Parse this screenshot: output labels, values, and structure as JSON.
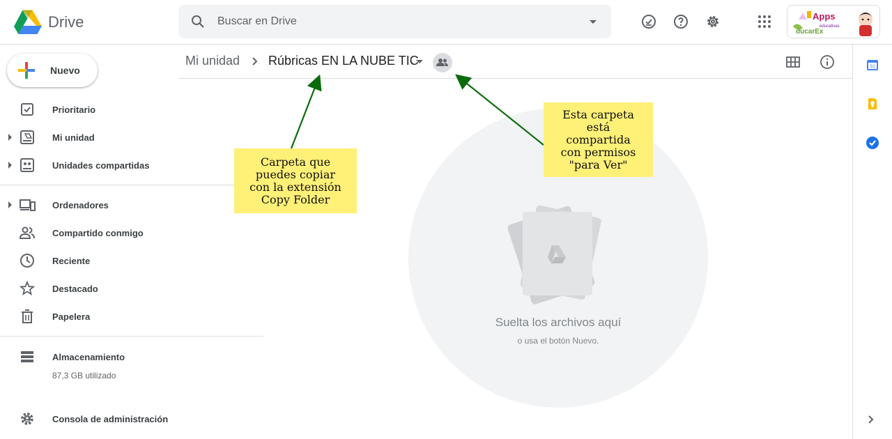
{
  "app": {
    "name": "Drive"
  },
  "search": {
    "placeholder": "Buscar en Drive"
  },
  "header_icons": [
    "offline-ready-icon",
    "help-icon",
    "settings-icon",
    "apps-grid-icon"
  ],
  "account": {
    "logo_text_top": "Apps",
    "logo_text_sub": "educativas",
    "logo_text_main": "EducarEx"
  },
  "sidebar": {
    "new_button": "Nuevo",
    "items": [
      {
        "label": "Prioritario",
        "icon": "priority-icon",
        "expandable": false
      },
      {
        "label": "Mi unidad",
        "icon": "my-drive-icon",
        "expandable": true
      },
      {
        "label": "Unidades compartidas",
        "icon": "shared-drives-icon",
        "expandable": true
      },
      {
        "label": "Ordenadores",
        "icon": "computers-icon",
        "expandable": true
      },
      {
        "label": "Compartido conmigo",
        "icon": "shared-with-me-icon",
        "expandable": false
      },
      {
        "label": "Reciente",
        "icon": "clock-icon",
        "expandable": false
      },
      {
        "label": "Destacado",
        "icon": "star-icon",
        "expandable": false
      },
      {
        "label": "Papelera",
        "icon": "trash-icon",
        "expandable": false
      }
    ],
    "storage": {
      "label": "Almacenamiento",
      "used": "87,3 GB utilizado"
    },
    "admin": {
      "label": "Consola de administración"
    }
  },
  "breadcrumb": {
    "root": "Mi unidad",
    "current": "Rúbricas EN LA NUBE TIC"
  },
  "dropzone": {
    "title": "Suelta los archivos aquí",
    "subtitle": "o usa el botón Nuevo."
  },
  "annotations": {
    "note1": "Carpeta que\npuedes copiar\ncon la extensión\nCopy Folder",
    "note2": "Esta carpeta\nestá\ncompartida\ncon permisos\n\"para Ver\""
  },
  "colors": {
    "arrow": "#0b6b0b",
    "note_bg": "#fff078",
    "accent_blue": "#1a73e8"
  }
}
